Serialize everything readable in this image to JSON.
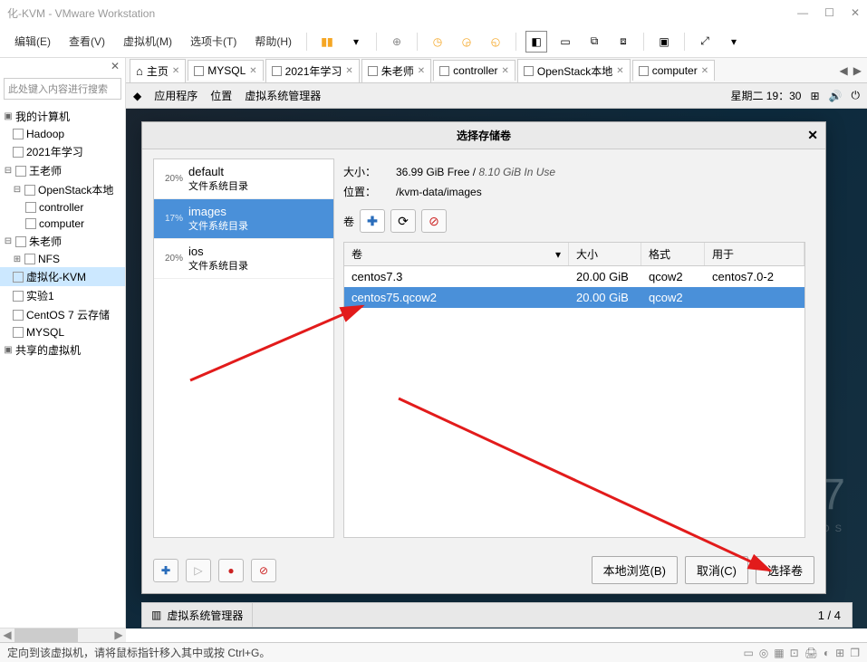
{
  "window": {
    "title": "化-KVM - VMware Workstation"
  },
  "menu": {
    "edit": "编辑(E)",
    "view": "查看(V)",
    "vm": "虚拟机(M)",
    "tabs": "选项卡(T)",
    "help": "帮助(H)"
  },
  "sidebar": {
    "search_placeholder": "此处键入内容进行搜索",
    "root": "我的计算机",
    "items": [
      "Hadoop",
      "2021年学习",
      "王老师",
      "OpenStack本地",
      "controller",
      "computer",
      "朱老师",
      "NFS",
      "虚拟化-KVM",
      "实验1",
      "CentOS 7 云存储",
      "MYSQL"
    ],
    "shared": "共享的虚拟机"
  },
  "tabs": {
    "home": "主页",
    "list": [
      "MYSQL",
      "2021年学习",
      "朱老师",
      "controller",
      "OpenStack本地",
      "computer"
    ]
  },
  "gnome": {
    "apps": "应用程序",
    "places": "位置",
    "vmm": "虚拟系统管理器",
    "time": "星期二 19：30"
  },
  "dialog": {
    "title": "选择存储卷",
    "size_label": "大小：",
    "size_value": "36.99 GiB Free / ",
    "size_inuse": "8.10 GiB In Use",
    "loc_label": "位置：",
    "loc_value": "/kvm-data/images",
    "vol_label": "卷",
    "pools": [
      {
        "pct": "20%",
        "name": "default",
        "sub": "文件系统目录"
      },
      {
        "pct": "17%",
        "name": "images",
        "sub": "文件系统目录"
      },
      {
        "pct": "20%",
        "name": "ios",
        "sub": "文件系统目录"
      }
    ],
    "columns": {
      "name": "卷",
      "size": "大小",
      "fmt": "格式",
      "used": "用于"
    },
    "rows": [
      {
        "name": "centos7.3",
        "size": "20.00 GiB",
        "fmt": "qcow2",
        "used": "centos7.0-2"
      },
      {
        "name": "centos75.qcow2",
        "size": "20.00 GiB",
        "fmt": "qcow2",
        "used": ""
      }
    ],
    "browse": "本地浏览(B)",
    "cancel": "取消(C)",
    "choose": "选择卷"
  },
  "taskbar": {
    "app": "虚拟系统管理器",
    "page": "1 / 4"
  },
  "status": {
    "msg": "定向到该虚拟机，请将鼠标指针移入其中或按 Ctrl+G。"
  },
  "centos": {
    "big": "7",
    "sub": "TOS"
  }
}
